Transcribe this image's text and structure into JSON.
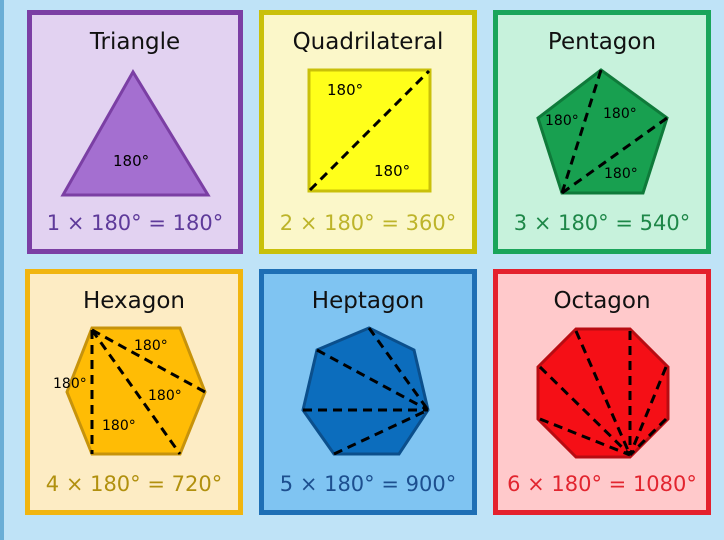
{
  "cards": [
    {
      "title": "Triangle",
      "formula": "1 × 180° = 180°",
      "angles": [
        "180°"
      ],
      "bg": "#e2d2f1",
      "border": "#7b3fa4",
      "fill": "#a46fd0",
      "text": "#5e3a9a"
    },
    {
      "title": "Quadrilateral",
      "formula": "2 × 180° = 360°",
      "angles": [
        "180°",
        "180°"
      ],
      "bg": "#fbf7c9",
      "border": "#c9c00a",
      "fill": "#ffff1a",
      "text": "#bdb42a"
    },
    {
      "title": "Pentagon",
      "formula": "3 × 180° = 540°",
      "angles": [
        "180°",
        "180°",
        "180°"
      ],
      "bg": "#c7f2dc",
      "border": "#1aa55b",
      "fill": "#18a050",
      "text": "#1e8748"
    },
    {
      "title": "Hexagon",
      "formula": "4 × 180° = 720°",
      "angles": [
        "180°",
        "180°",
        "180°",
        "180°"
      ],
      "bg": "#fdecc4",
      "border": "#f1b510",
      "fill": "#ffbc05",
      "text": "#b1900e"
    },
    {
      "title": "Heptagon",
      "formula": "5 × 180° = 900°",
      "angles": [],
      "bg": "#7fc4f2",
      "border": "#1e6fb5",
      "fill": "#0c6dbd",
      "text": "#1d4f8f"
    },
    {
      "title": "Octagon",
      "formula": "6 × 180° = 1080°",
      "angles": [],
      "bg": "#ffc9cb",
      "border": "#e4212d",
      "fill": "#f50f16",
      "text": "#e2252f"
    }
  ]
}
